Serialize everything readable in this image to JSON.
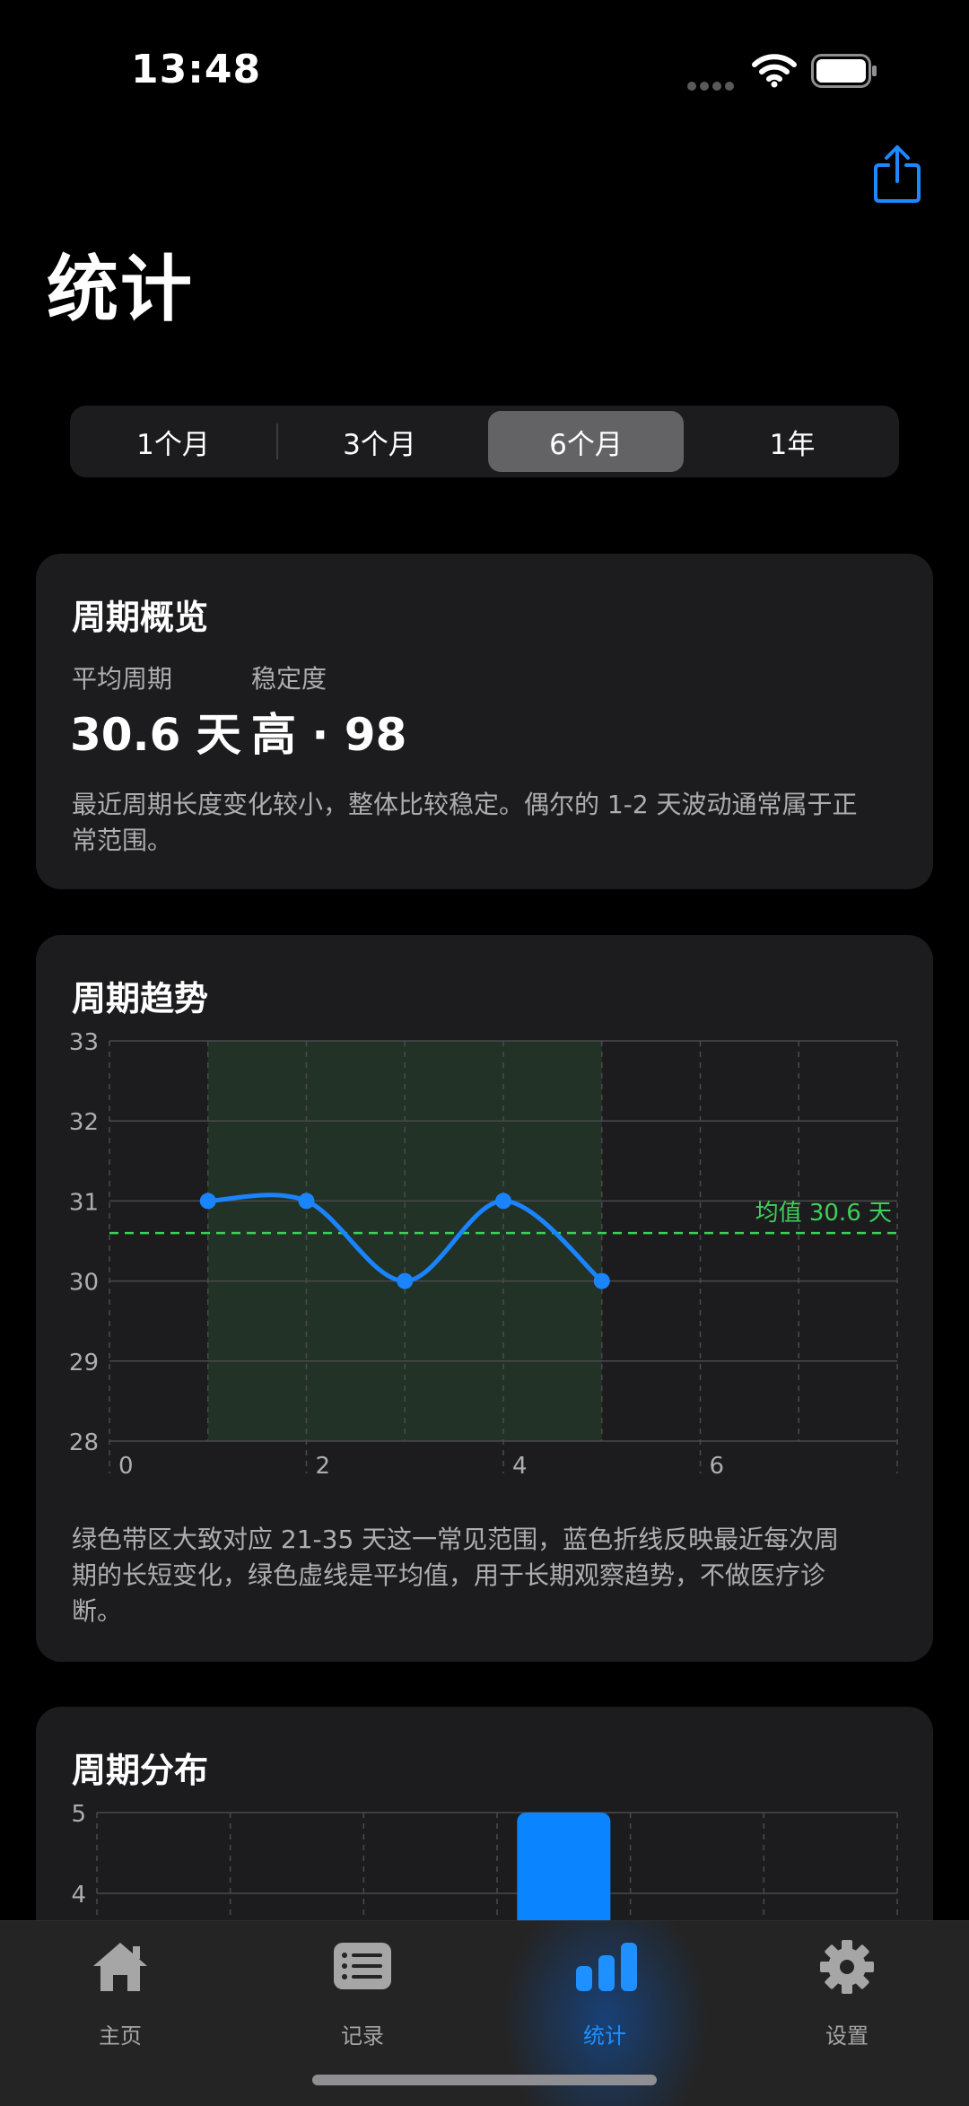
{
  "status_bar": {
    "time": "13:48"
  },
  "page": {
    "title": "统计"
  },
  "segmented": {
    "options": [
      "1个月",
      "3个月",
      "6个月",
      "1年"
    ],
    "selected": "6个月"
  },
  "overview": {
    "title": "周期概览",
    "avg_label": "平均周期",
    "avg_value": "30.6 天",
    "stability_label": "稳定度",
    "stability_value": "高 · 98",
    "description": "最近周期长度变化较小，整体比较稳定。偶尔的 1-2 天波动通常属于正常范围。"
  },
  "trend": {
    "title": "周期趋势",
    "description": "绿色带区大致对应 21-35 天这一常见范围，蓝色折线反映最近每次周期的长短变化，绿色虚线是平均值，用于长期观察趋势，不做医疗诊断。"
  },
  "distribution": {
    "title": "周期分布"
  },
  "chart_data": [
    {
      "type": "line",
      "x": [
        1,
        2,
        3,
        4,
        5
      ],
      "values": [
        31,
        31,
        30,
        31,
        30
      ],
      "xlim": [
        0,
        8
      ],
      "ylim": [
        28,
        33
      ],
      "x_ticks": [
        0,
        2,
        4,
        6
      ],
      "y_ticks": [
        28,
        29,
        30,
        31,
        32,
        33
      ],
      "band_x": [
        1,
        5
      ],
      "mean": 30.6,
      "mean_label": "均值 30.6 天",
      "colors": {
        "line": "#1a84ff",
        "mean": "#3ecf5a",
        "band": "#223226"
      },
      "grid": true
    },
    {
      "type": "bar",
      "x": [
        3.5
      ],
      "values": [
        5
      ],
      "xlim": [
        0,
        6
      ],
      "y_ticks": [
        4,
        5
      ],
      "ylim_visible": [
        3.65,
        5
      ],
      "colors": {
        "bar": "#0a84ff"
      },
      "grid": true
    }
  ],
  "tabbar": {
    "tabs": [
      {
        "label": "主页",
        "icon": "house-icon"
      },
      {
        "label": "记录",
        "icon": "list-icon"
      },
      {
        "label": "统计",
        "icon": "chart-bar-icon"
      },
      {
        "label": "设置",
        "icon": "gear-icon"
      }
    ],
    "active": "统计",
    "active_color": "#1e90ff",
    "inactive_color": "#a6a6a6"
  }
}
